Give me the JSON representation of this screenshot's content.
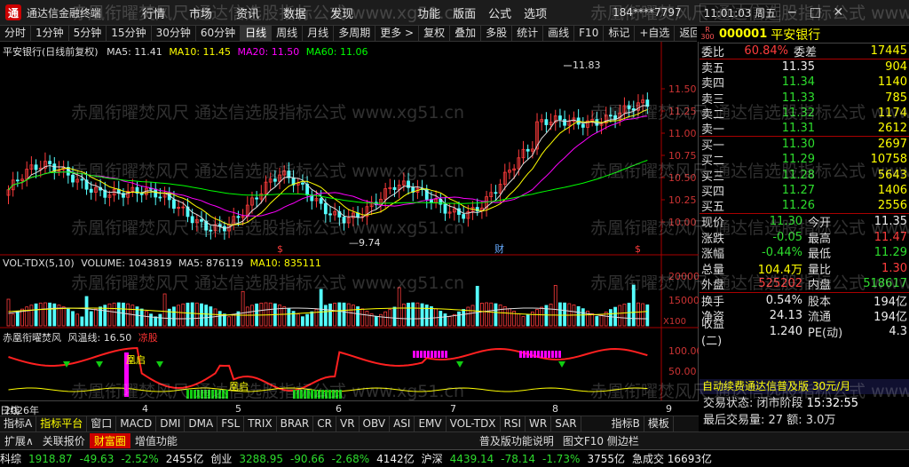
{
  "titlebar": {
    "app_title": "通达信金融终端",
    "menu": [
      "行情",
      "市场",
      "资讯",
      "数据",
      "发现"
    ],
    "menu2": [
      "功能",
      "版面",
      "公式",
      "选项"
    ],
    "user": "184****7797",
    "clock": "11:01:03 周五",
    "window_buttons": [
      "−",
      "□",
      "✕"
    ]
  },
  "toolbar": {
    "items": [
      "分时",
      "1分钟",
      "5分钟",
      "15分钟",
      "30分钟",
      "60分钟",
      "日线",
      "周线",
      "月线",
      "多周期",
      "更多 >",
      "复权",
      "叠加",
      "多股",
      "统计",
      "画线",
      "F10",
      "标记",
      "+自选",
      "返回"
    ],
    "active": "日线"
  },
  "chart": {
    "legend_main": {
      "name": "平安银行(日线前复权)",
      "ma5": "MA5: 11.41",
      "ma10": "MA10: 11.45",
      "ma20": "MA20: 11.50",
      "ma60": "MA60: 11.06"
    },
    "price_ticks": [
      "11.50",
      "11.25",
      "11.00",
      "10.75",
      "10.50",
      "10.25",
      "10.00"
    ],
    "high_label": "11.83",
    "low_label": "9.74",
    "marks": [
      "$",
      "$",
      "财",
      "$"
    ],
    "legend_vol": {
      "name": "VOL-TDX(5,10)",
      "vol": "VOLUME: 1043819",
      "ma5": "MA5: 876119",
      "ma10": "MA10: 835111"
    },
    "vol_ticks": [
      "20000",
      "15000"
    ],
    "vol_unit": "X100",
    "legend_ind": {
      "name": "赤凰衔曜焚风",
      "sub": "风温线: 16.50",
      "tag": "凉股"
    },
    "ind_ticks": [
      "100.00",
      "50.00"
    ],
    "ind_labels": [
      "凰启",
      "凰启"
    ]
  },
  "right_panel": {
    "code": "000001",
    "name": "平安银行",
    "rbox": "R 300",
    "ratio": {
      "label": "委比",
      "value": "60.84%",
      "label2": "委差",
      "value2": "17445"
    },
    "asks": [
      {
        "label": "卖五",
        "price": "11.35",
        "vol": "904",
        "color": "wht"
      },
      {
        "label": "卖四",
        "price": "11.34",
        "vol": "1140",
        "color": "grn"
      },
      {
        "label": "卖三",
        "price": "11.33",
        "vol": "785",
        "color": "grn"
      },
      {
        "label": "卖二",
        "price": "11.32",
        "vol": "1174",
        "color": "grn"
      },
      {
        "label": "卖一",
        "price": "11.31",
        "vol": "2612",
        "color": "grn"
      }
    ],
    "bids": [
      {
        "label": "买一",
        "price": "11.30",
        "vol": "2697",
        "color": "grn"
      },
      {
        "label": "买二",
        "price": "11.29",
        "vol": "10758",
        "color": "grn"
      },
      {
        "label": "买三",
        "price": "11.28",
        "vol": "5643",
        "color": "grn"
      },
      {
        "label": "买四",
        "price": "11.27",
        "vol": "1406",
        "color": "grn"
      },
      {
        "label": "买五",
        "price": "11.26",
        "vol": "2556",
        "color": "grn"
      }
    ],
    "quotes": [
      {
        "l1": "现价",
        "v1": "11.30",
        "c1": "grn",
        "l2": "今开",
        "v2": "11.35",
        "c2": "wht"
      },
      {
        "l1": "涨跌",
        "v1": "-0.05",
        "c1": "grn",
        "l2": "最高",
        "v2": "11.47",
        "c2": "red"
      },
      {
        "l1": "涨幅",
        "v1": "-0.44%",
        "c1": "grn",
        "l2": "最低",
        "v2": "11.29",
        "c2": "grn"
      },
      {
        "l1": "总量",
        "v1": "104.4万",
        "c1": "yel",
        "l2": "量比",
        "v2": "1.30",
        "c2": "red"
      },
      {
        "l1": "外盘",
        "v1": "525202",
        "c1": "red",
        "l2": "内盘",
        "v2": "518617",
        "c2": "grn"
      }
    ],
    "quotes2": [
      {
        "l1": "换手",
        "v1": "0.54%",
        "c1": "wht",
        "l2": "股本",
        "v2": "194亿",
        "c2": "wht"
      },
      {
        "l1": "净资",
        "v1": "24.13",
        "c1": "wht",
        "l2": "流通",
        "v2": "194亿",
        "c2": "wht"
      },
      {
        "l1": "收益(二)",
        "v1": "1.240",
        "c1": "wht",
        "l2": "PE(动)",
        "v2": "4.3",
        "c2": "wht"
      }
    ],
    "ad": "自动续费通达信普及版 30元/月",
    "trade_state": "交易状态: 闭市阶段",
    "trade_time": "15:32:55",
    "last_vol": "最后交易量: 27",
    "total": "额: 3.0万"
  },
  "date_axis": [
    "2026年",
    "4",
    "5",
    "6",
    "7",
    "8",
    "9",
    "日线"
  ],
  "ind_tabs": {
    "items": [
      "指标A",
      "指标平台",
      "窗口",
      "MACD",
      "DMI",
      "DMA",
      "FSL",
      "TRIX",
      "BRAR",
      "CR",
      "VR",
      "OBV",
      "ASI",
      "EMV",
      "VOL-TDX",
      "RSI",
      "WR",
      "SAR",
      "指标B",
      "模板"
    ],
    "active": "指标平台"
  },
  "sub_tabs": {
    "items": [
      "扩展∧",
      "关联报价",
      "财富圈",
      "增值功能"
    ],
    "right": [
      "普及版功能说明",
      "图文F10 侧边栏"
    ],
    "hot": "财富圈"
  },
  "ticker": [
    {
      "name": "科综",
      "val": "1918.87",
      "chg": "-49.63",
      "pct": "-2.52%",
      "amt": "2455亿"
    },
    {
      "name": "创业",
      "val": "3288.95",
      "chg": "-90.66",
      "pct": "-2.68%",
      "amt": "4142亿"
    },
    {
      "name": "沪深",
      "val": "4439.14",
      "chg": "-78.14",
      "pct": "-1.73%",
      "amt": "3755亿"
    }
  ],
  "ticker_tail": "急成交 16693亿",
  "watermark": "赤凰衔曜焚风尺 通达信选股指标公式 www.xg51.cn"
}
